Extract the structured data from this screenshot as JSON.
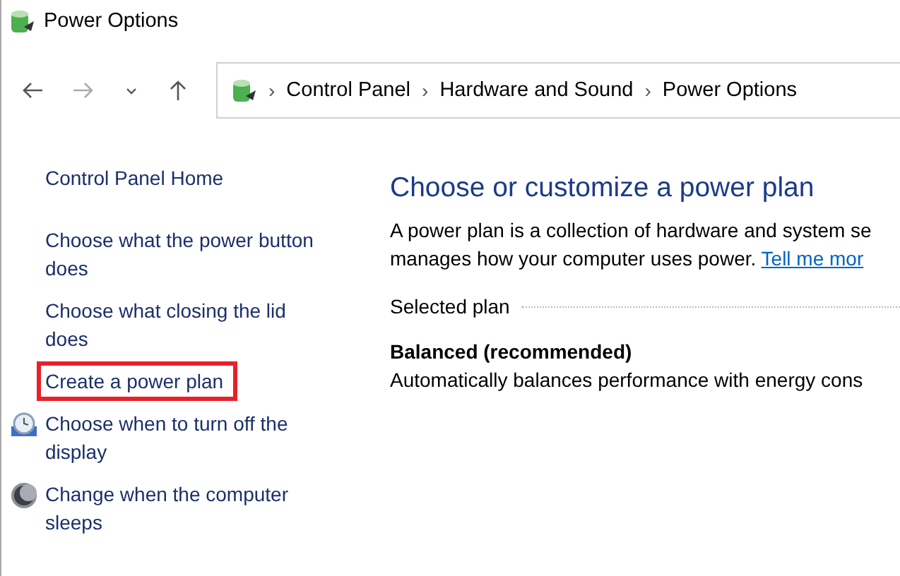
{
  "window": {
    "title": "Power Options"
  },
  "nav": {
    "breadcrumbs": [
      "Control Panel",
      "Hardware and Sound",
      "Power Options"
    ],
    "separator": "›"
  },
  "sidebar": {
    "home": "Control Panel Home",
    "items": [
      {
        "label": "Choose what the power button does",
        "kind": "plain",
        "highlighted": false
      },
      {
        "label": "Choose what closing the lid does",
        "kind": "plain",
        "highlighted": false
      },
      {
        "label": "Create a power plan",
        "kind": "plain",
        "highlighted": true
      },
      {
        "label": "Choose when to turn off the display",
        "kind": "display",
        "highlighted": false
      },
      {
        "label": "Change when the computer sleeps",
        "kind": "sleep",
        "highlighted": false
      }
    ]
  },
  "main": {
    "heading": "Choose or customize a power plan",
    "intro_lines": [
      "A power plan is a collection of hardware and system se",
      "manages how your computer uses power."
    ],
    "link": "Tell me mor",
    "section": "Selected plan",
    "plan_name": "Balanced (recommended)",
    "plan_description": "Automatically balances performance with energy cons"
  }
}
